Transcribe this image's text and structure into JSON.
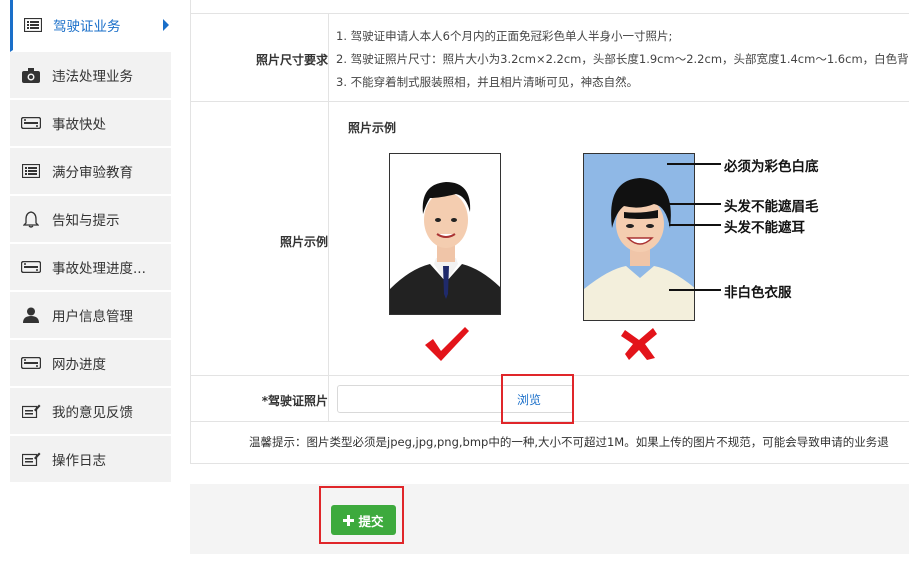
{
  "sidebar": {
    "items": [
      {
        "label": "驾驶证业务",
        "icon": "list-icon",
        "active": true
      },
      {
        "label": "违法处理业务",
        "icon": "camera-icon"
      },
      {
        "label": "事故快处",
        "icon": "ticket-icon"
      },
      {
        "label": "满分审验教育",
        "icon": "list-icon"
      },
      {
        "label": "告知与提示",
        "icon": "bell-icon"
      },
      {
        "label": "事故处理进度...",
        "icon": "ticket-icon"
      },
      {
        "label": "用户信息管理",
        "icon": "user-icon"
      },
      {
        "label": "网办进度",
        "icon": "ticket-icon"
      },
      {
        "label": "我的意见反馈",
        "icon": "edit-icon"
      },
      {
        "label": "操作日志",
        "icon": "edit-icon"
      }
    ]
  },
  "form": {
    "size_label": "照片尺寸要求",
    "size_requirements": [
      "1. 驾驶证申请人本人6个月内的正面免冠彩色单人半身小一寸照片;",
      "2. 驾驶证照片尺寸：照片大小为3.2cm×2.2cm，头部长度1.9cm～2.2cm，头部宽度1.4cm～1.6cm，白色背",
      "3. 不能穿着制式服装照相，并且相片清晰可见，神态自然。"
    ],
    "example_label": "照片示例",
    "example_title": "照片示例",
    "annotations": {
      "bg": "必须为彩色白底",
      "brow": "头发不能遮眉毛",
      "ear": "头发不能遮耳",
      "clothes": "非白色衣服"
    },
    "upload_label": "*驾驶证照片",
    "upload_value": "",
    "browse_label": "浏览",
    "tip": "温馨提示：图片类型必须是jpeg,jpg,png,bmp中的一种,大小不可超过1M。如果上传的图片不规范，可能会导致申请的业务退"
  },
  "submit": {
    "icon": "plus-icon",
    "label": "提交"
  },
  "colors": {
    "accent": "#1a6fc9",
    "submit": "#3daa3d",
    "highlight": "#e0262a",
    "check": "#e3141a"
  }
}
